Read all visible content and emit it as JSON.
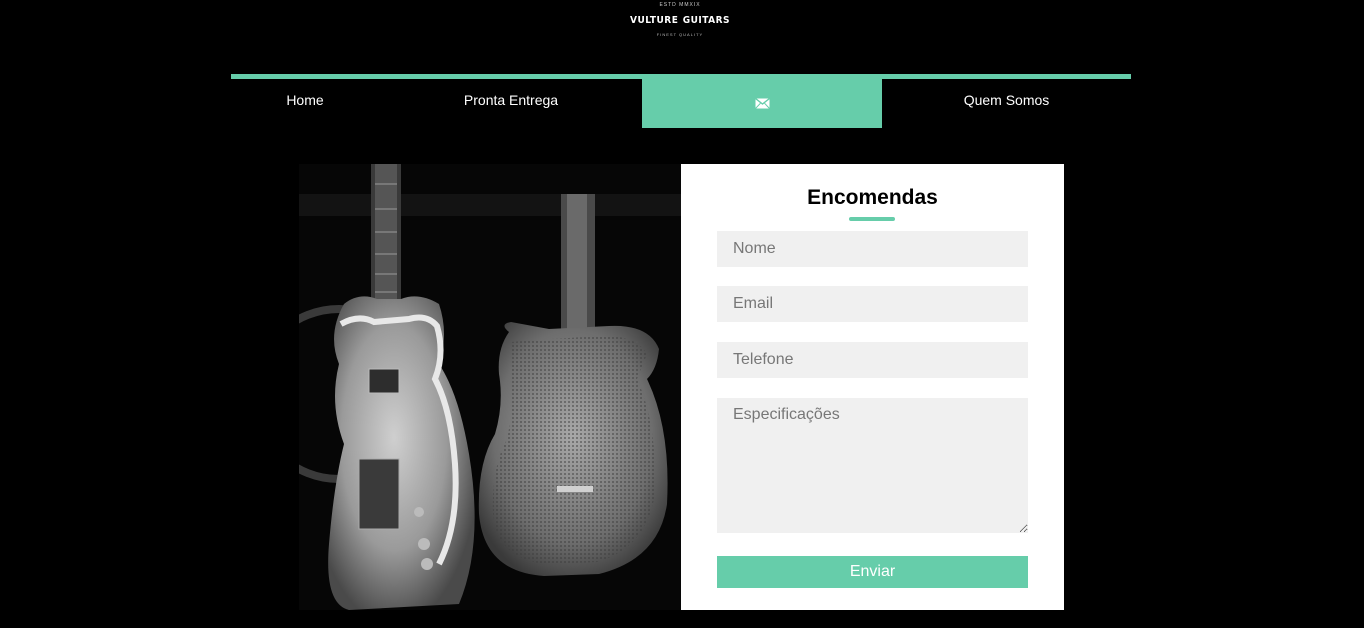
{
  "logo": {
    "top_text": "ESTD MMXIX",
    "brand_left": "VULTURE",
    "brand_right": "GUITARS",
    "tagline": "FINEST QUALITY"
  },
  "nav": {
    "items": [
      {
        "label": "Home"
      },
      {
        "label": "Pronta Entrega"
      },
      {
        "icon": "envelope-icon"
      },
      {
        "label": "Quem Somos"
      }
    ]
  },
  "form": {
    "title": "Encomendas",
    "name_placeholder": "Nome",
    "email_placeholder": "Email",
    "phone_placeholder": "Telefone",
    "specs_placeholder": "Especificações",
    "submit_label": "Enviar"
  },
  "colors": {
    "accent": "#66cdaa",
    "background": "#000000",
    "field_bg": "#f0f0f0"
  }
}
